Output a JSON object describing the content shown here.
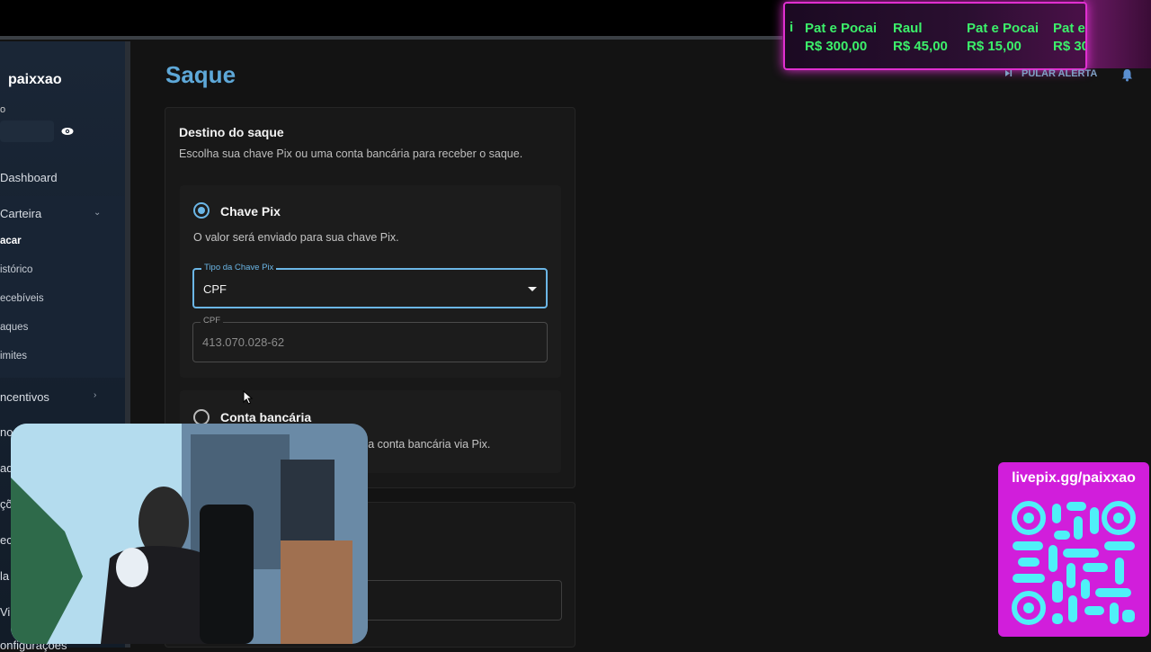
{
  "sidebar": {
    "user_name": "paixxao",
    "user_label": "o",
    "nav": {
      "dashboard": "Dashboard",
      "carteira": "Carteira",
      "incentivos": "ncentivos",
      "configuracoes": "onfigurações"
    },
    "wallet_sub": [
      "acar",
      "istórico",
      "ecebíveis",
      "aques",
      "imites"
    ],
    "cut_items": [
      "no",
      "ad",
      "çõ",
      "ec",
      "la",
      "Vi"
    ]
  },
  "main": {
    "title": "Saque",
    "destination": {
      "title": "Destino do saque",
      "description": "Escolha sua chave Pix ou uma conta bancária para receber o saque."
    },
    "pix": {
      "title": "Chave Pix",
      "description": "O valor será enviado para sua chave Pix.",
      "key_type_label": "Tipo da Chave Pix",
      "key_type_value": "CPF",
      "cpf_label": "CPF",
      "cpf_value": "413.070.028-62"
    },
    "bank": {
      "title": "Conta bancária",
      "description": "sua conta bancária via Pix."
    }
  },
  "overlay": {
    "skip_alert": "PULAR ALERTA",
    "ticker_prefix": "i",
    "donations": [
      {
        "name": "Pat e Pocai",
        "amount": "R$ 300,00"
      },
      {
        "name": "Raul",
        "amount": "R$ 45,00"
      },
      {
        "name": "Pat e Pocai",
        "amount": "R$ 15,00"
      },
      {
        "name": "Pat e",
        "amount": "R$ 30"
      }
    ],
    "qr_url": "livepix.gg/paixxao"
  },
  "colors": {
    "accent": "#6bb6e6",
    "title": "#5ea8d8",
    "ticker_border": "#e02fd0",
    "ticker_text": "#3cf06a",
    "qr_panel": "#d11edb"
  }
}
